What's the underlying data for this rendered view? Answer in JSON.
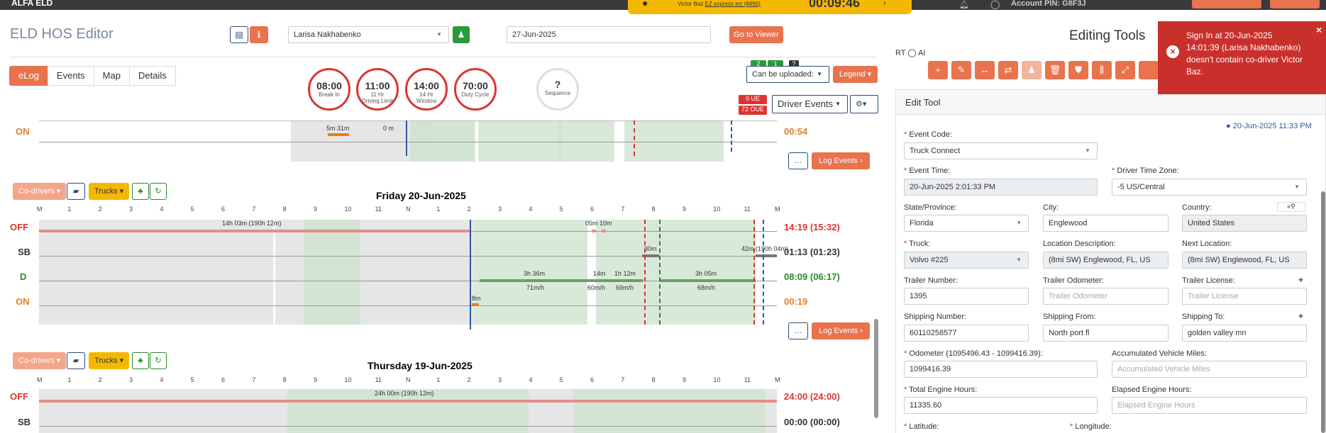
{
  "topbar": {
    "brand": "ALFA ELD",
    "timer_driver": "Victor Baz",
    "timer_company": "EZ express inc (8490)",
    "timer_clock": "00:09:46",
    "account_pin": "Account PIN: G8F3J"
  },
  "header": {
    "title": "ELD HOS Editor",
    "driver_select": "Larisa Nakhabenko",
    "date": "27-Jun-2025",
    "go_to_viewer": "Go to Viewer"
  },
  "tabs": [
    "eLog",
    "Events",
    "Map",
    "Details"
  ],
  "circles": [
    {
      "value": "08:00",
      "label1": "Break In",
      "label2": ""
    },
    {
      "value": "11:00",
      "label1": "11 Hr",
      "label2": "Driving Limit"
    },
    {
      "value": "14:00",
      "label1": "14 Hr",
      "label2": "Window"
    },
    {
      "value": "70:00",
      "label1": "Duty Cycle",
      "label2": ""
    }
  ],
  "sequence": {
    "value": "?",
    "label": "Sequence"
  },
  "upload": {
    "badge1": "2",
    "badge2": "1",
    "badge3": "?",
    "select": "Can be uploaded:",
    "legend": "Legend"
  },
  "ue": {
    "ue": "0 UE",
    "oue": "72 OUE",
    "driver_events": "Driver Events"
  },
  "row_on": {
    "label": "ON",
    "time": "00:54",
    "bar_labels": [
      "5m 31m",
      "0 m"
    ]
  },
  "log_events": "Log Events",
  "controls": {
    "codrivers": "Co-drivers",
    "trucks": "Trucks"
  },
  "day1": {
    "title": "Friday 20-Jun-2025",
    "ticks": [
      "M",
      "1",
      "2",
      "3",
      "4",
      "5",
      "6",
      "7",
      "8",
      "9",
      "10",
      "11",
      "N",
      "1",
      "2",
      "3",
      "4",
      "5",
      "6",
      "7",
      "8",
      "9",
      "10",
      "11",
      "M"
    ],
    "rows": [
      {
        "label": "OFF",
        "color": "#d33",
        "time": "14:19 (15:32)"
      },
      {
        "label": "SB",
        "color": "#333",
        "time": "01:13 (01:23)"
      },
      {
        "label": "D",
        "color": "#2a8a2a",
        "time": "08:09 (06:17)"
      },
      {
        "label": "ON",
        "color": "#e67e22",
        "time": "00:19"
      }
    ],
    "off_label": "14h 03m (190h 12m)",
    "off_label2": "05m 10m",
    "sb_labels": [
      "30m",
      "42m (190h 04m)"
    ],
    "d_labels": [
      "3h 36m",
      "71m/h",
      "14m",
      "60m/h",
      "1h 12m",
      "69m/h",
      "3h 05m",
      "68m/h"
    ],
    "on_label": "8m"
  },
  "day2": {
    "title": "Thursday 19-Jun-2025",
    "rows": [
      {
        "label": "OFF",
        "color": "#d33",
        "time": "24:00 (24:00)"
      },
      {
        "label": "SB",
        "color": "#333",
        "time": "00:00 (00:00)"
      }
    ],
    "off_label": "24h 00m (190h 12m)"
  },
  "tools": {
    "title": "Editing Tools",
    "rt_label": "RT",
    "ai_label": "AI",
    "edit_title": "Edit Tool",
    "timestamp": "20-Jun-2025 11:33 PM"
  },
  "form": {
    "event_code_label": "Event Code:",
    "event_code": "Truck Connect",
    "event_time_label": "Event Time:",
    "event_time": "20-Jun-2025 2:01:33 PM",
    "tz_label": "Driver Time Zone:",
    "tz": "-5 US/Central",
    "state_label": "State/Province:",
    "state": "Florida",
    "city_label": "City:",
    "city": "Englewood",
    "country_label": "Country:",
    "country": "United States",
    "truck_label": "Truck:",
    "truck": "Volvo #225",
    "locdesc_label": "Location Description:",
    "locdesc": "(8mi SW) Englewood, FL, US",
    "nextloc_label": "Next Location:",
    "nextloc": "(8mi SW) Englewood, FL, US",
    "trailer_num_label": "Trailer Number:",
    "trailer_num": "1395",
    "trailer_odo_label": "Trailer Odometer:",
    "trailer_odo_ph": "Trailer Odometer",
    "trailer_lic_label": "Trailer License:",
    "trailer_lic_ph": "Trailer License",
    "ship_num_label": "Shipping Number:",
    "ship_num": "60110258577",
    "ship_from_label": "Shipping From:",
    "ship_from": "North port fl",
    "ship_to_label": "Shipping To:",
    "ship_to": "golden valley mn",
    "odo_label": "Odometer (1095496.43 - 1099416.39):",
    "odo": "1099416.39",
    "acc_miles_label": "Accumulated Vehicle Miles:",
    "acc_miles_ph": "Accumulated Vehicle Miles",
    "engine_label": "Total Engine Hours:",
    "engine": "11335.60",
    "elapsed_label": "Elapsed Engine Hours:",
    "elapsed_ph": "Elapsed Engine Hours",
    "lat_label": "Latitude:",
    "lon_label": "Longitude:"
  },
  "toast": {
    "text": "Sign In at 20-Jun-2025 14:01:39 (Larisa Nakhabenko) doesn't contain co-driver Victor Baz."
  }
}
